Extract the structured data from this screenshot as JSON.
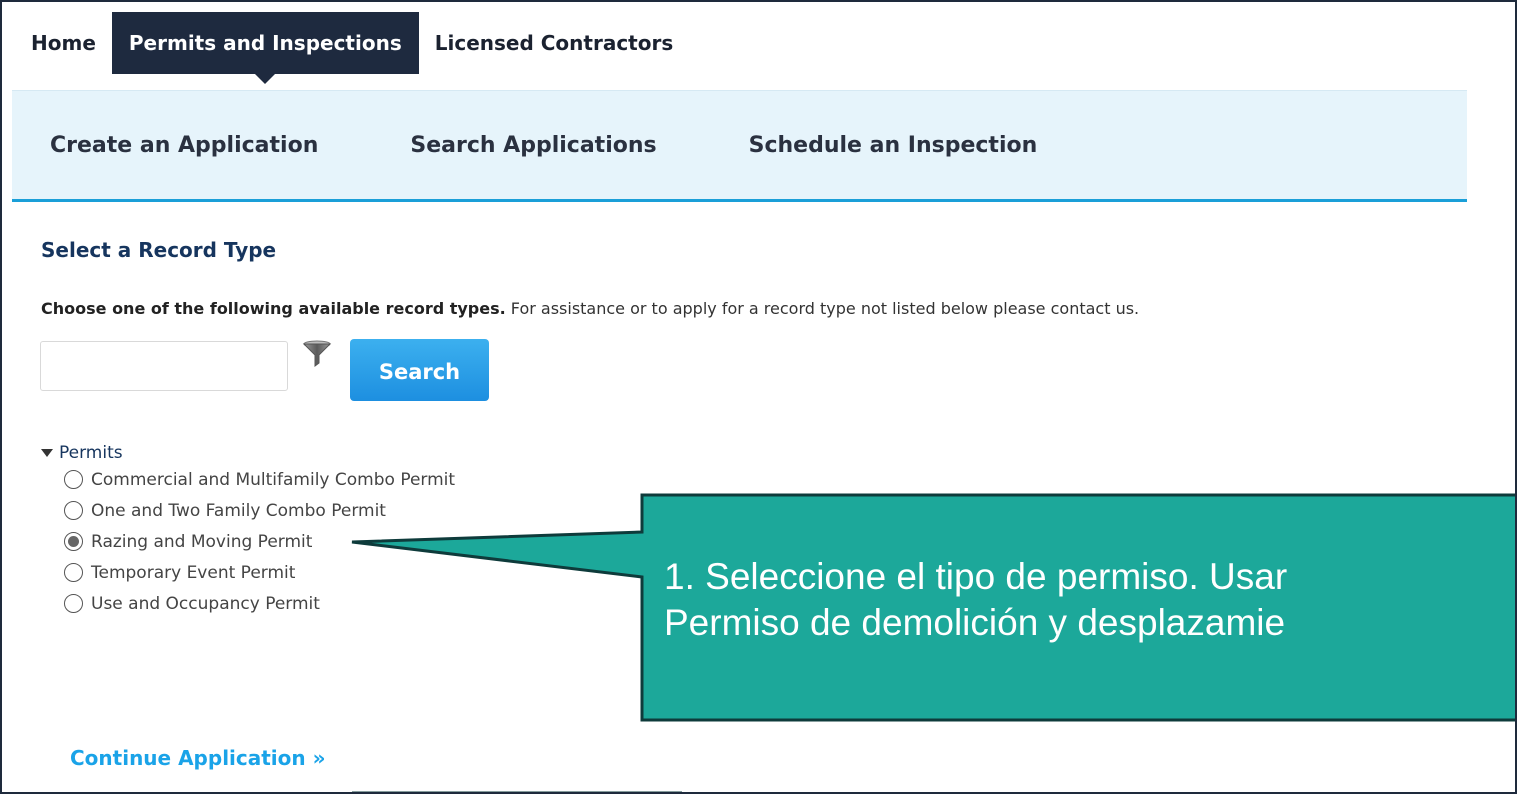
{
  "top_nav": {
    "home": "Home",
    "permits": "Permits and Inspections",
    "contractors": "Licensed Contractors"
  },
  "sub_nav": {
    "create": "Create an Application",
    "search": "Search Applications",
    "schedule": "Schedule an Inspection"
  },
  "section": {
    "title": "Select a Record Type",
    "instruction_bold": "Choose one of the following available record types.",
    "instruction_rest": " For assistance or to apply for a record type not listed below please contact us."
  },
  "search": {
    "input_value": "",
    "button_label": "Search",
    "filter_icon": "filter-funnel-icon"
  },
  "tree": {
    "group_label": "Permits",
    "group_expanded": true,
    "selected_index": 2,
    "options": [
      "Commercial and Multifamily Combo Permit",
      "One and Two Family Combo Permit",
      "Razing and Moving Permit",
      "Temporary Event Permit",
      "Use and Occupancy Permit"
    ]
  },
  "continue": {
    "label": "Continue Application »"
  },
  "callout": {
    "line1": "1. Seleccione el tipo de permiso. Usar",
    "line2": "Permiso de demolición y desplazamie",
    "fill_color": "#1ca89a",
    "border_color": "#0e3b3b"
  },
  "colors": {
    "active_tab": "#1e2a3f",
    "subnav_bg": "#e6f4fb",
    "accent": "#1a9fd8",
    "button": "#1d8fe0",
    "heading": "#16355e"
  }
}
